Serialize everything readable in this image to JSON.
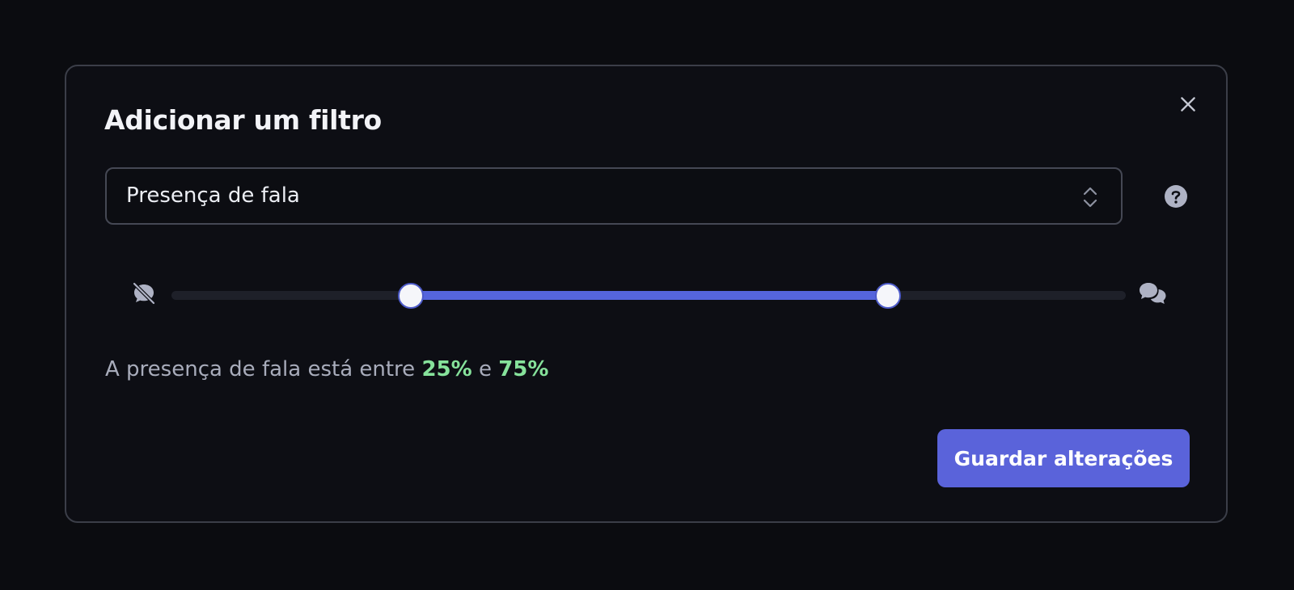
{
  "dialog": {
    "title": "Adicionar um filtro",
    "close_icon": "close-icon",
    "help_icon": "help-circle-icon"
  },
  "filter_select": {
    "selected": "Presença de fala",
    "chevron_icon": "chevron-up-down-icon"
  },
  "range_slider": {
    "min_icon": "no-speech-icon",
    "max_icon": "speech-bubbles-icon",
    "lower_value_percent": 25,
    "upper_value_percent": 75
  },
  "summary": {
    "prefix": "A presença de fala está entre",
    "lower": "25%",
    "conjunction": "e",
    "upper": "75%"
  },
  "footer": {
    "save_label": "Guardar alterações"
  },
  "colors": {
    "accent": "#5565dc",
    "value_green": "#86e29b",
    "background": "#0d0e14"
  }
}
